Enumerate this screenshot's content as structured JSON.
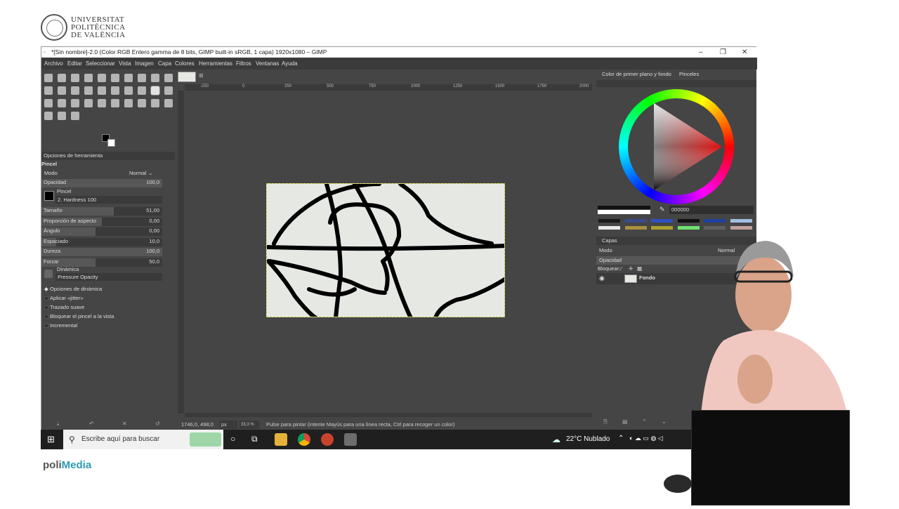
{
  "logo": {
    "line1": "UNIVERSITAT",
    "line2": "POLITÈCNICA",
    "line3": "DE VALÈNCIA"
  },
  "footer": {
    "brand_a": "poli",
    "brand_b": "Media"
  },
  "window": {
    "title": "*[Sin nombre]-2.0 (Color RGB Entero gamma de 8 bits, GIMP built-in sRGB, 1 capa) 1920x1080 – GIMP",
    "minimize": "–",
    "maximize": "❐",
    "close": "✕"
  },
  "menu": [
    "Archivo",
    "Editar",
    "Seleccionar",
    "Vista",
    "Imagen",
    "Capa",
    "Colores",
    "Herramientas",
    "Filtros",
    "Ventanas",
    "Ayuda"
  ],
  "tool_options": {
    "header": "Opciones de herramienta",
    "tool_name": "Pincel",
    "mode_label": "Modo",
    "mode_value": "Normal",
    "opacity_label": "Opacidad",
    "opacity_value": "100,0",
    "brush_label": "Pincel",
    "brush_value": "2. Hardness 100",
    "sliders": [
      {
        "label": "Tamaño",
        "value": "51,00",
        "fill": 0.6
      },
      {
        "label": "Proporción de aspecto",
        "value": "0,00",
        "fill": 0.5
      },
      {
        "label": "Ángulo",
        "value": "0,00",
        "fill": 0.45
      },
      {
        "label": "Espaciado",
        "value": "10,0",
        "fill": 0.12
      },
      {
        "label": "Dureza",
        "value": "100,0",
        "fill": 1.0
      },
      {
        "label": "Forzar",
        "value": "50,0",
        "fill": 0.45
      }
    ],
    "dynamics_label": "Dinámica",
    "dynamics_value": "Pressure Opacity",
    "dyn_options": "Opciones de dinámica",
    "checks": [
      "Aplicar «jitter»",
      "Trazado suave",
      "Bloquear el pincel a la vista",
      "Incremental"
    ]
  },
  "ruler": {
    "ticks": [
      "-250",
      "0",
      "250",
      "500",
      "750",
      "1000",
      "1250",
      "1500",
      "1750",
      "2000"
    ]
  },
  "status": {
    "coords": "1746,0, 498,0",
    "unit": "px",
    "zoom": "33,3 %",
    "message": "Pulse para pintar (intente Mayús para una línea recta, Ctrl para recoger un color)"
  },
  "right_panel": {
    "tab_fg": "Color de primer plano y fondo",
    "tab_brushes": "Pinceles",
    "hex": "000000",
    "swatches": [
      "#1a1a1a",
      "#3a4a8a",
      "#3050c0",
      "#111111",
      "#2040a0",
      "#a0c0e0",
      "#e8e8e8",
      "#a89040",
      "#a8a030",
      "#70e070",
      "#606060",
      "#c0a0a0"
    ],
    "layers_title": "Capas",
    "mode_label": "Modo",
    "mode_value": "Normal",
    "opacity_label": "Opacidad",
    "lock_label": "Bloquear:",
    "layer_name": "Fondo"
  },
  "taskbar": {
    "search_placeholder": "Escribe aquí para buscar",
    "weather": "22°C Nublado"
  }
}
